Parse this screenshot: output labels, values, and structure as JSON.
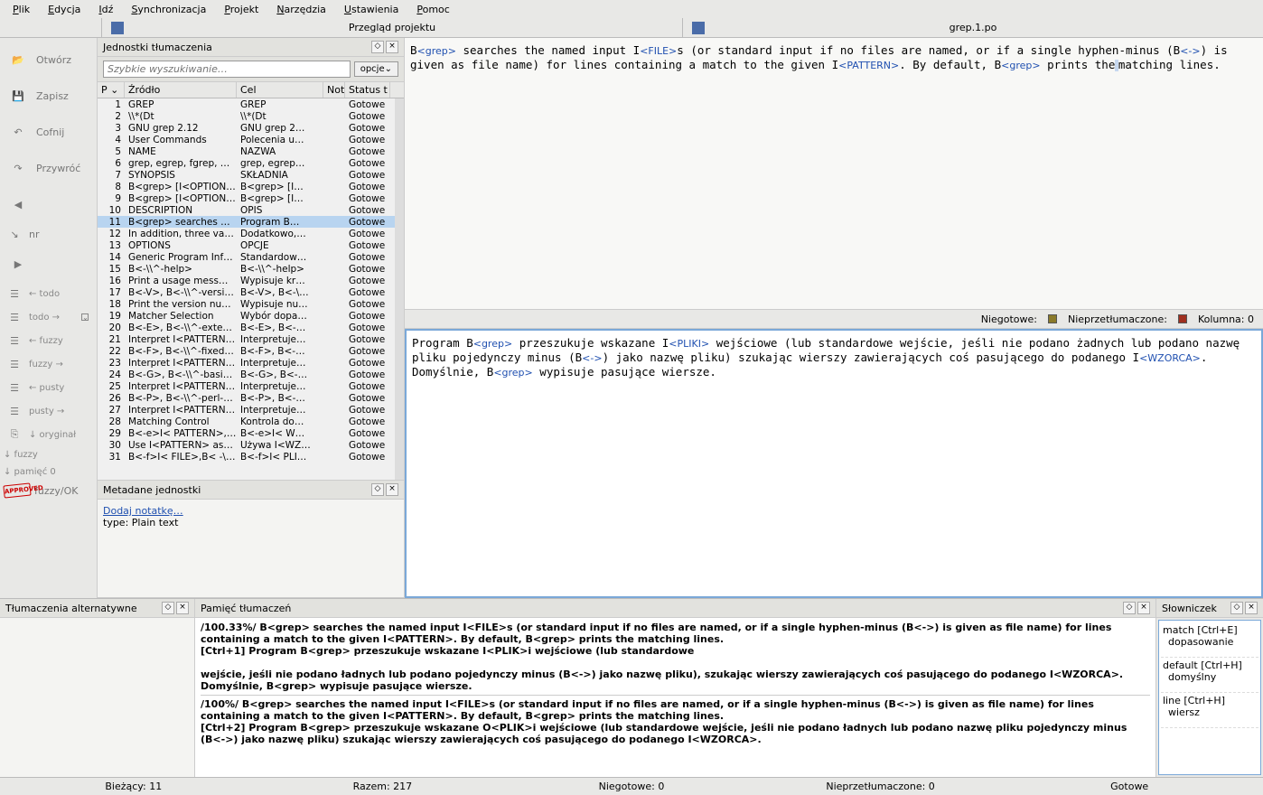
{
  "menu": [
    "Plik",
    "Edycja",
    "Idź",
    "Synchronizacja",
    "Projekt",
    "Narzędzia",
    "Ustawienia",
    "Pomoc"
  ],
  "tabs": {
    "left": "Przegląd projektu",
    "right": "grep.1.po"
  },
  "left_tools": {
    "open": "Otwórz",
    "save": "Zapisz",
    "undo": "Cofnij",
    "redo": "Przywróć",
    "arrow_nr": "nr",
    "todo_left": "← todo",
    "todo_right": "todo →",
    "fuzzy_left": "← fuzzy",
    "fuzzy_right": "fuzzy →",
    "pusty_left": "← pusty",
    "pusty_right": "pusty →",
    "oryginal": "↓ oryginał",
    "fuzzy_btn": "↓ fuzzy",
    "pamiec": "↓ pamięć 0",
    "fuzzyok": "fuzzy/OK",
    "fuzzyok_chev": "⌄"
  },
  "units_panel": {
    "title": "Jednostki tłumaczenia",
    "search_placeholder": "Szybkie wyszukiwanie…",
    "opcje": "opcje⌄",
    "headers": {
      "p": "P ⌄",
      "zrodlo": "Źródło",
      "cel": "Cel",
      "not": "Not",
      "status": "Status t"
    },
    "rows": [
      {
        "p": "1",
        "src": "GREP",
        "tgt": "GREP",
        "st": "Gotowe"
      },
      {
        "p": "2",
        "src": "\\\\*(Dt",
        "tgt": "\\\\*(Dt",
        "st": "Gotowe"
      },
      {
        "p": "3",
        "src": "GNU grep 2.12",
        "tgt": "GNU grep 2…",
        "st": "Gotowe"
      },
      {
        "p": "4",
        "src": "User Commands",
        "tgt": "Polecenia u…",
        "st": "Gotowe"
      },
      {
        "p": "5",
        "src": "NAME",
        "tgt": "NAZWA",
        "st": "Gotowe"
      },
      {
        "p": "6",
        "src": "grep, egrep, fgrep, …",
        "tgt": "grep, egrep…",
        "st": "Gotowe"
      },
      {
        "p": "7",
        "src": "SYNOPSIS",
        "tgt": "SKŁADNIA",
        "st": "Gotowe"
      },
      {
        "p": "8",
        "src": "B<grep> [I<OPTION…",
        "tgt": "B<grep> [I…",
        "st": "Gotowe"
      },
      {
        "p": "9",
        "src": "B<grep> [I<OPTION…",
        "tgt": "B<grep> [I…",
        "st": "Gotowe"
      },
      {
        "p": "10",
        "src": "DESCRIPTION",
        "tgt": "OPIS",
        "st": "Gotowe"
      },
      {
        "p": "11",
        "src": "B<grep> searches …",
        "tgt": "Program B…",
        "st": "Gotowe",
        "sel": true
      },
      {
        "p": "12",
        "src": "In addition, three va…",
        "tgt": "Dodatkowo,…",
        "st": "Gotowe"
      },
      {
        "p": "13",
        "src": "OPTIONS",
        "tgt": "OPCJE",
        "st": "Gotowe"
      },
      {
        "p": "14",
        "src": "Generic Program Inf…",
        "tgt": "Standardow…",
        "st": "Gotowe"
      },
      {
        "p": "15",
        "src": "B<-\\\\^-help>",
        "tgt": "B<-\\\\^-help>",
        "st": "Gotowe"
      },
      {
        "p": "16",
        "src": "Print a usage mess…",
        "tgt": "Wypisuje kr…",
        "st": "Gotowe"
      },
      {
        "p": "17",
        "src": "B<-V>, B<-\\\\^-versi…",
        "tgt": "B<-V>, B<-\\…",
        "st": "Gotowe"
      },
      {
        "p": "18",
        "src": "Print the version nu…",
        "tgt": "Wypisuje nu…",
        "st": "Gotowe"
      },
      {
        "p": "19",
        "src": "Matcher Selection",
        "tgt": "Wybór dopa…",
        "st": "Gotowe"
      },
      {
        "p": "20",
        "src": "B<-E>, B<-\\\\^-exte…",
        "tgt": "B<-E>, B<-…",
        "st": "Gotowe"
      },
      {
        "p": "21",
        "src": "Interpret I<PATTERN…",
        "tgt": "Interpretuje…",
        "st": "Gotowe"
      },
      {
        "p": "22",
        "src": "B<-F>, B<-\\\\^-fixed…",
        "tgt": "B<-F>, B<-…",
        "st": "Gotowe"
      },
      {
        "p": "23",
        "src": "Interpret I<PATTERN…",
        "tgt": "Interpretuje…",
        "st": "Gotowe"
      },
      {
        "p": "24",
        "src": "B<-G>, B<-\\\\^-basi…",
        "tgt": "B<-G>, B<-…",
        "st": "Gotowe"
      },
      {
        "p": "25",
        "src": "Interpret I<PATTERN…",
        "tgt": "Interpretuje…",
        "st": "Gotowe"
      },
      {
        "p": "26",
        "src": "B<-P>, B<-\\\\^-perl-…",
        "tgt": "B<-P>, B<-…",
        "st": "Gotowe"
      },
      {
        "p": "27",
        "src": "Interpret I<PATTERN…",
        "tgt": "Interpretuje…",
        "st": "Gotowe"
      },
      {
        "p": "28",
        "src": "Matching Control",
        "tgt": "Kontrola do…",
        "st": "Gotowe"
      },
      {
        "p": "29",
        "src": "B<-e>I< PATTERN>,…",
        "tgt": "B<-e>I< W…",
        "st": "Gotowe"
      },
      {
        "p": "30",
        "src": "Use I<PATTERN> as…",
        "tgt": "Używa I<WZ…",
        "st": "Gotowe"
      },
      {
        "p": "31",
        "src": "B<-f>I< FILE>,B< -\\…",
        "tgt": "B<-f>I< PLI…",
        "st": "Gotowe"
      }
    ]
  },
  "meta_panel": {
    "title": "Metadane jednostki",
    "add_note": "Dodaj notatkę…",
    "type_line": "type: Plain text"
  },
  "editor_source_html": "B<span class='tag'>&lt;grep&gt;</span> searches the named input I<span class='tag'>&lt;FILE&gt;</span>s (or standard input if no files are named, or if a single hyphen-minus (B<span class='tag'>&lt;-&gt;</span>)  is given as file name)  for lines containing a match to the given I<span class='tag'>&lt;PATTERN&gt;</span>.  By default, B<span class='tag'>&lt;grep&gt;</span> prints the<span class='sel-bg'> </span>matching lines.",
  "editor_status": {
    "niegotowe": "Niegotowe:",
    "nieprzet": "Nieprzetłumaczone:",
    "kolumna": "Kolumna: 0"
  },
  "editor_target_html": "Program B<span class='tag'>&lt;grep&gt;</span> przeszukuje wskazane I<span class='tag'>&lt;PLIKI&gt;</span> wejściowe (lub standardowe wejście, jeśli nie podano żadnych lub podano nazwę pliku pojedynczy minus (B<span class='tag'>&lt;-&gt;</span>) jako nazwę pliku) szukając wierszy zawierających coś pasującego do podanego I<span class='tag'>&lt;WZORCA&gt;</span>. Domyślnie, B<span class='tag'>&lt;grep&gt;</span> wypisuje pasujące wiersze.",
  "alt_panel": {
    "title": "Tłumaczenia alternatywne"
  },
  "tm_panel": {
    "title": "Pamięć tłumaczeń",
    "body_html": "<b>/100.33%/ B&lt;grep&gt; searches the named input I&lt;FILE&gt;s (or standard input if no files are named, or if a single hyphen-minus (B&lt;-&gt;) is given as file name) for lines containing a match to the given I&lt;PATTERN&gt;. By default, B&lt;grep&gt; prints the matching lines.</b><br><b>[Ctrl+1] Program B&lt;grep&gt; przeszukuje wskazane I&lt;PLIK&gt;i wejściowe (lub standardowe</b><br><br><b>wejście, jeśli nie podano ładnych lub podano pojedynczy minus (B&lt;-&gt;) jako nazwę pliku), szukając wierszy zawierających coś pasującego do podanego I&lt;WZORCA&gt;. Domyślnie, B&lt;grep&gt; wypisuje pasujące wiersze.</b><hr><b>/100%/ B&lt;grep&gt; searches the named input I&lt;FILE&gt;s (or standard input if no files are named, or if a single hyphen-minus (B&lt;-&gt;) is given as file name) for lines containing a match to the given I&lt;PATTERN&gt;. By default, B&lt;grep&gt; prints the matching lines.</b><br><b>[Ctrl+2] Program B&lt;grep&gt; przeszukuje wskazane O&lt;PLIK&gt;i wejściowe (lub standardowe wejście, jeśli nie podano ładnych lub podano nazwę pliku pojedynczy minus (B&lt;-&gt;) jako nazwę pliku) szukając wierszy zawierających coś pasującego do podanego I&lt;WZORCA&gt;.</b>"
  },
  "gloss_panel": {
    "title": "Słowniczek",
    "items": [
      {
        "h": "match [Ctrl+E]",
        "b": "dopasowanie"
      },
      {
        "h": "default [Ctrl+H]",
        "b": "domyślny"
      },
      {
        "h": "line [Ctrl+H]",
        "b": "wiersz"
      }
    ]
  },
  "status": {
    "biezacy": "Bieżący: 11",
    "razem": "Razem: 217",
    "niegotowe": "Niegotowe: 0",
    "nieprzet": "Nieprzetłumaczone: 0",
    "gotowe": "Gotowe"
  }
}
